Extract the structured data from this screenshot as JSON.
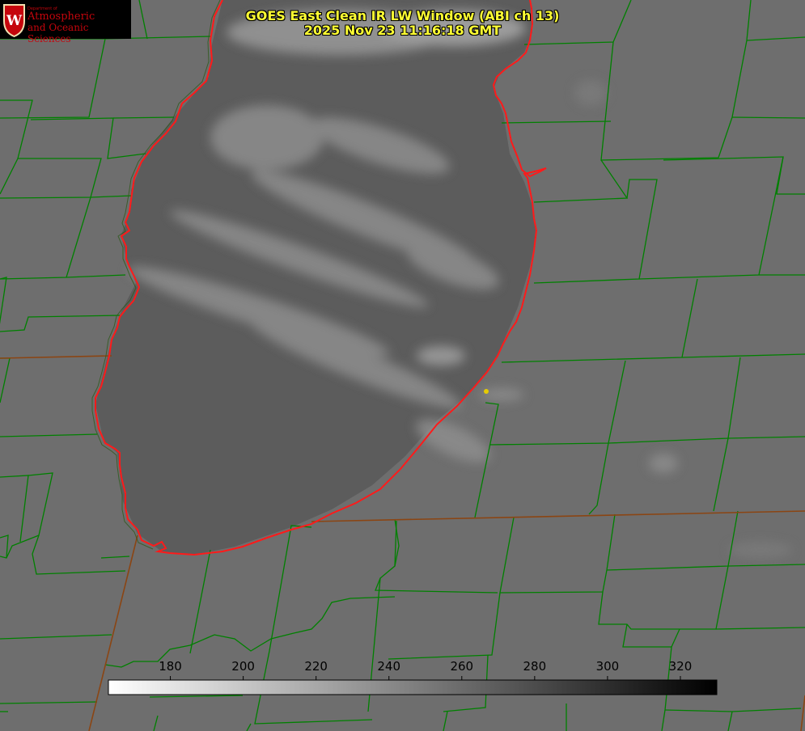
{
  "logo": {
    "dept": "Department of",
    "line1": "Atmospheric",
    "line2": "and Oceanic Sciences",
    "badge_letter": "W"
  },
  "title": {
    "line1": "GOES East Clean IR LW Window (ABI ch 13)",
    "line2": "2025 Nov 23 11:16:18 GMT"
  },
  "colorbar": {
    "ticks": [
      "180",
      "200",
      "220",
      "240",
      "260",
      "280",
      "300",
      "320"
    ],
    "min": 163,
    "max": 330,
    "gradient_from": "#ffffff",
    "gradient_to": "#000000"
  },
  "colors": {
    "county_border": "#008000",
    "state_border": "#8b4513",
    "coastline": "#ff1a1a",
    "title_text": "#ffff33",
    "point_marker": "#e6cc00",
    "lake_surface": "#5c5c5c",
    "land_surface": "#6e6e6e"
  }
}
